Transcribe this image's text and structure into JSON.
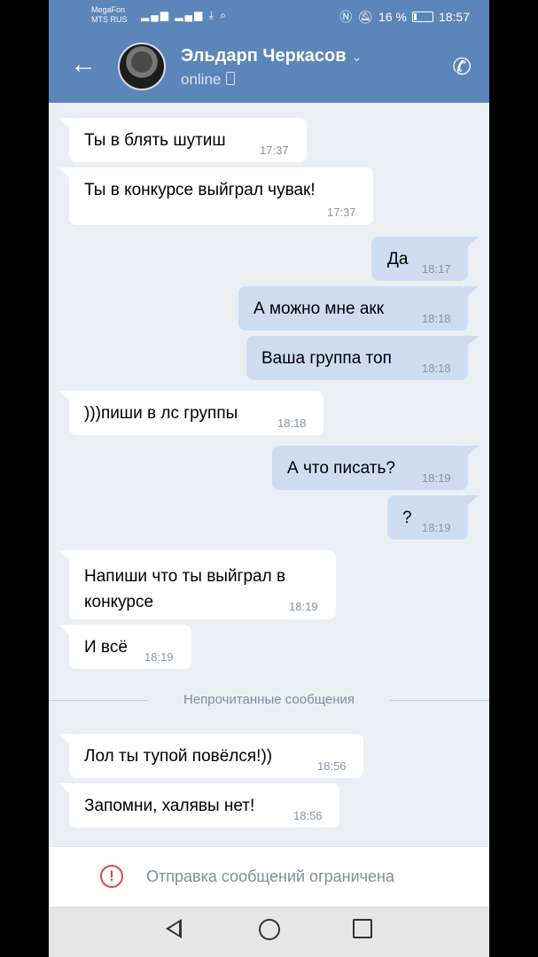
{
  "status_bar": {
    "carrier1": "MegaFon",
    "carrier2": "MTS RUS",
    "battery_text": "16 %",
    "time": "18:57"
  },
  "header": {
    "name": "Эльдарп Черкасов",
    "presence": "online"
  },
  "messages": [
    {
      "side": "in",
      "text": "Ты в блять шутиш",
      "time": "17:37"
    },
    {
      "side": "in",
      "text": "Ты в конкурсе выйграл чувак!",
      "time": "17:37"
    },
    {
      "side": "out",
      "text": "Да",
      "time": "18:17"
    },
    {
      "side": "out",
      "text": "А можно мне акк",
      "time": "18:18"
    },
    {
      "side": "out",
      "text": "Ваша группа топ",
      "time": "18:18"
    },
    {
      "side": "in",
      "text": ")))пиши в лс группы",
      "time": "18:18"
    },
    {
      "side": "out",
      "text": "А что писать?",
      "time": "18:19"
    },
    {
      "side": "out",
      "text": "?",
      "time": "18:19"
    },
    {
      "side": "in",
      "text": "Напиши что ты выйграл в конкурсе",
      "time": "18:19"
    },
    {
      "side": "in",
      "text": "И всё",
      "time": "18:19"
    },
    {
      "side": "in",
      "text": "Лол ты тупой повёлся!))",
      "time": "18:56"
    },
    {
      "side": "in",
      "text": "Запомни, халявы нет!",
      "time": "18:56"
    }
  ],
  "divider_label": "Непрочитанные сообщения",
  "restricted_text": "Отправка сообщений ограничена",
  "colors": {
    "header": "#5c85ba",
    "incoming": "#ffffff",
    "outgoing": "#cddcf0",
    "background": "#ebeff4",
    "warning": "#e64646"
  }
}
